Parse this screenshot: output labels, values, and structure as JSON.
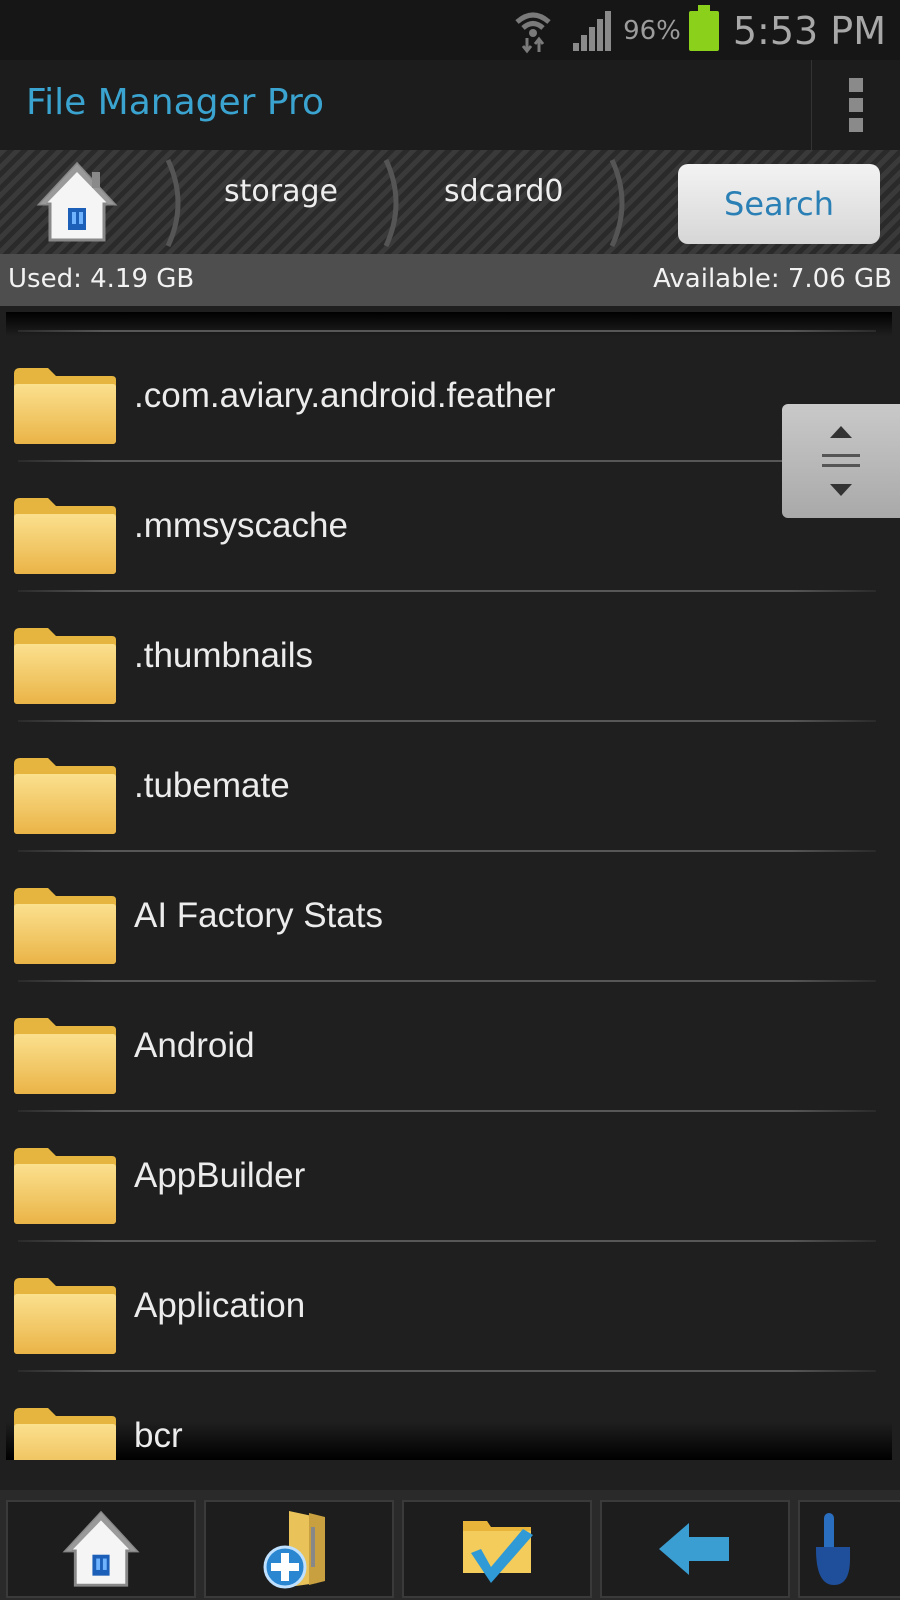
{
  "status_bar": {
    "battery_percent": "96%",
    "time": "5:53 PM",
    "icons": [
      "wifi-icon",
      "signal-icon",
      "battery-icon"
    ],
    "battery_color": "#8bd01b"
  },
  "action_bar": {
    "title": "File Manager Pro",
    "title_color": "#3aa3cf",
    "overflow_icon": "overflow-menu-icon"
  },
  "breadcrumb": {
    "home_icon": "home-icon",
    "items": [
      {
        "label": "storage"
      },
      {
        "label": "sdcard0"
      }
    ],
    "search_label": "Search"
  },
  "storage": {
    "used": "Used: 4.19 GB",
    "available": "Available: 7.06 GB"
  },
  "files": [
    {
      "name": ".com.aviary.android.feather",
      "type": "folder"
    },
    {
      "name": ".mmsyscache",
      "type": "folder"
    },
    {
      "name": ".thumbnails",
      "type": "folder"
    },
    {
      "name": ".tubemate",
      "type": "folder"
    },
    {
      "name": "AI Factory Stats",
      "type": "folder"
    },
    {
      "name": "Android",
      "type": "folder"
    },
    {
      "name": "AppBuilder",
      "type": "folder"
    },
    {
      "name": "Application",
      "type": "folder"
    },
    {
      "name": "bcr",
      "type": "folder"
    }
  ],
  "toolbar": {
    "buttons": [
      {
        "icon": "home-icon"
      },
      {
        "icon": "new-folder-icon"
      },
      {
        "icon": "select-folder-icon"
      },
      {
        "icon": "back-arrow-icon"
      },
      {
        "icon": "touch-hand-icon"
      }
    ]
  }
}
